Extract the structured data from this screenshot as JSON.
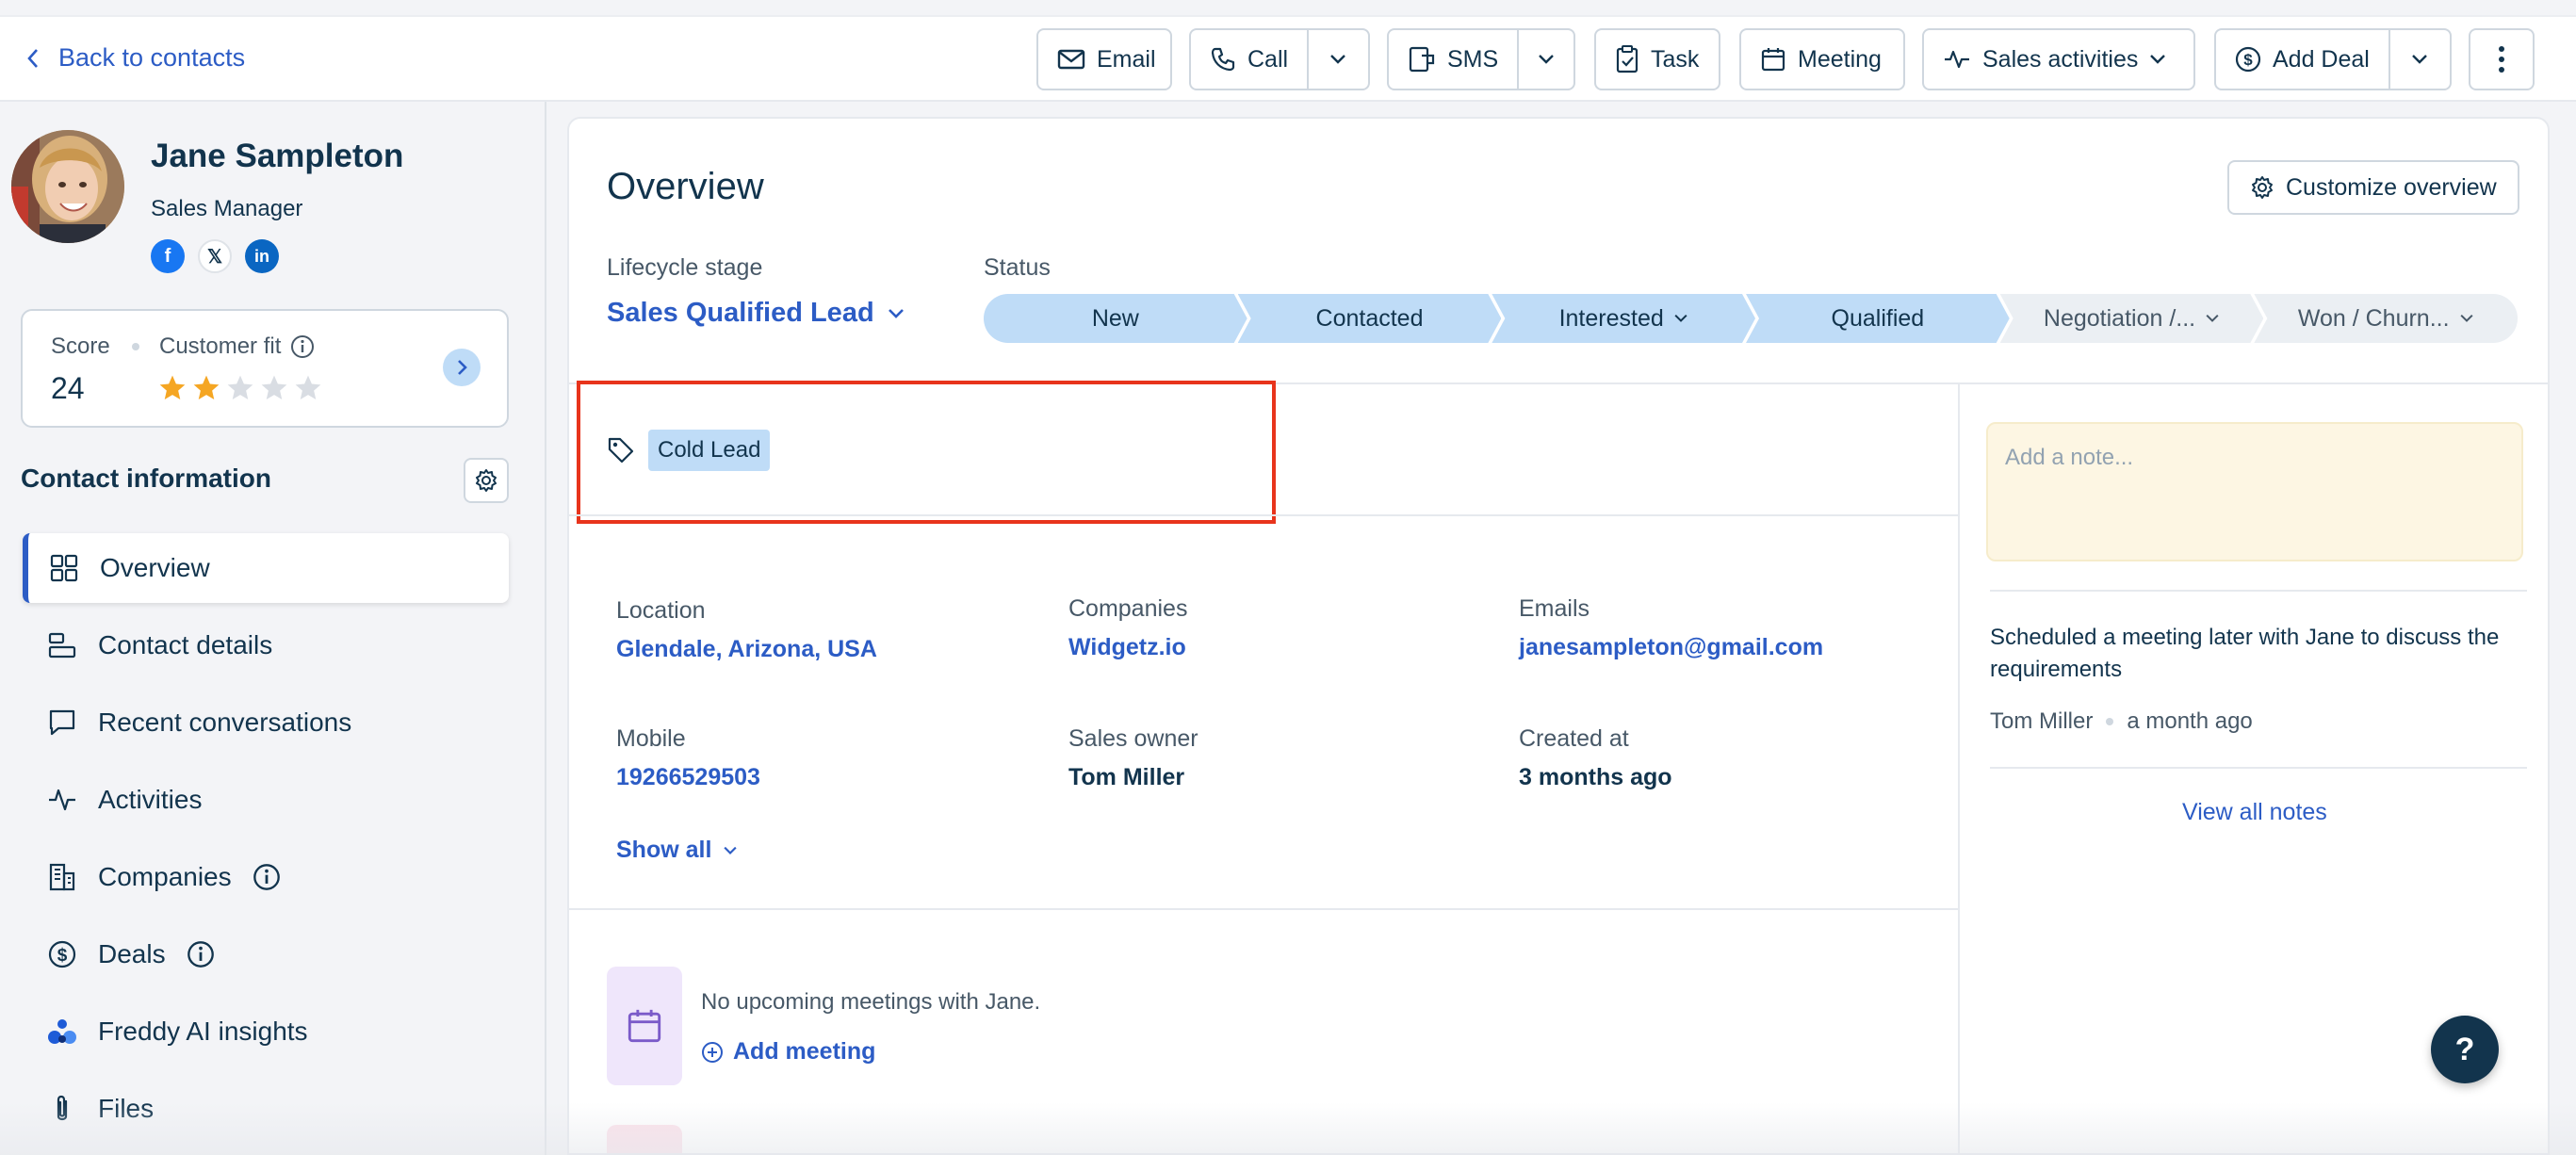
{
  "topbar": {
    "back_label": "Back to contacts",
    "email_label": "Email",
    "call_label": "Call",
    "sms_label": "SMS",
    "task_label": "Task",
    "meeting_label": "Meeting",
    "sales_activities_label": "Sales activities",
    "add_deal_label": "Add Deal"
  },
  "contact": {
    "name": "Jane Sampleton",
    "title": "Sales Manager",
    "socials": [
      "facebook",
      "x",
      "linkedin"
    ]
  },
  "score": {
    "score_label": "Score",
    "score_value": "24",
    "fit_label": "Customer fit",
    "fit_stars": 2,
    "fit_max": 5
  },
  "sidebar": {
    "section_title": "Contact information",
    "items": [
      {
        "label": "Overview",
        "icon": "grid-icon",
        "active": true
      },
      {
        "label": "Contact details",
        "icon": "details-icon"
      },
      {
        "label": "Recent conversations",
        "icon": "chat-icon"
      },
      {
        "label": "Activities",
        "icon": "activity-icon"
      },
      {
        "label": "Companies",
        "icon": "building-icon",
        "info": true
      },
      {
        "label": "Deals",
        "icon": "dollar-icon",
        "info": true
      },
      {
        "label": "Freddy AI insights",
        "icon": "freddy-icon"
      },
      {
        "label": "Files",
        "icon": "paperclip-icon"
      }
    ]
  },
  "overview": {
    "title": "Overview",
    "customize_label": "Customize overview",
    "lifecycle_label": "Lifecycle stage",
    "lifecycle_value": "Sales Qualified Lead",
    "status_label": "Status",
    "stages": [
      {
        "label": "New",
        "done": true
      },
      {
        "label": "Contacted",
        "done": true
      },
      {
        "label": "Interested",
        "done": true,
        "dropdown": true
      },
      {
        "label": "Qualified",
        "done": true
      },
      {
        "label": "Negotiation /...",
        "done": false,
        "dropdown": true
      },
      {
        "label": "Won / Churn...",
        "done": false,
        "dropdown": true
      }
    ],
    "tag": "Cold Lead",
    "fields": {
      "location_label": "Location",
      "location_value": "Glendale, Arizona, USA",
      "companies_label": "Companies",
      "companies_value": "Widgetz.io",
      "emails_label": "Emails",
      "emails_value": "janesampleton@gmail.com",
      "mobile_label": "Mobile",
      "mobile_value": "19266529503",
      "owner_label": "Sales owner",
      "owner_value": "Tom Miller",
      "created_label": "Created at",
      "created_value": "3 months ago"
    },
    "show_all_label": "Show all",
    "no_meetings_text": "No upcoming meetings with Jane.",
    "add_meeting_label": "Add meeting"
  },
  "notes": {
    "placeholder": "Add a note...",
    "note_text": "Scheduled a meeting later with Jane to discuss the requirements",
    "note_author": "Tom Miller",
    "note_time": "a month ago",
    "view_all_label": "View all notes"
  },
  "help_label": "?",
  "colors": {
    "accent": "#2c5cc5",
    "stage_done": "#bfdcf7",
    "stage_todo": "#ebeff3",
    "highlight": "#e8341c",
    "note_bg": "#fdf6e3"
  }
}
